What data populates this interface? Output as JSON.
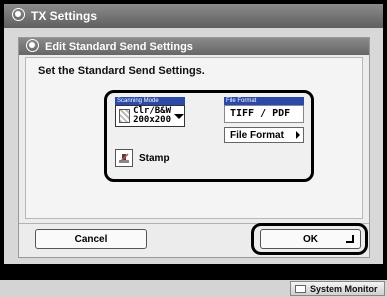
{
  "window": {
    "title": "TX Settings",
    "icon": "settings-gear-icon"
  },
  "dialog": {
    "title": "Edit Standard Send Settings",
    "icon": "settings-gear-icon",
    "instruction": "Set the Standard Send Settings."
  },
  "scanning_mode": {
    "label": "Scanning Mode",
    "value_line1": "Clr/B&W",
    "value_line2": "200x200",
    "icon": "scan-mode-icon"
  },
  "file_format": {
    "label": "File Format",
    "value": "TIFF / PDF",
    "button_label": "File Format"
  },
  "stamp": {
    "label": "Stamp",
    "icon": "stamp-icon"
  },
  "buttons": {
    "cancel": "Cancel",
    "ok": "OK"
  },
  "status_bar": {
    "system_monitor": "System Monitor"
  },
  "colors": {
    "header_gray": "#6f6f6f",
    "label_blue": "#2a49a8",
    "frame_black": "#000000"
  }
}
